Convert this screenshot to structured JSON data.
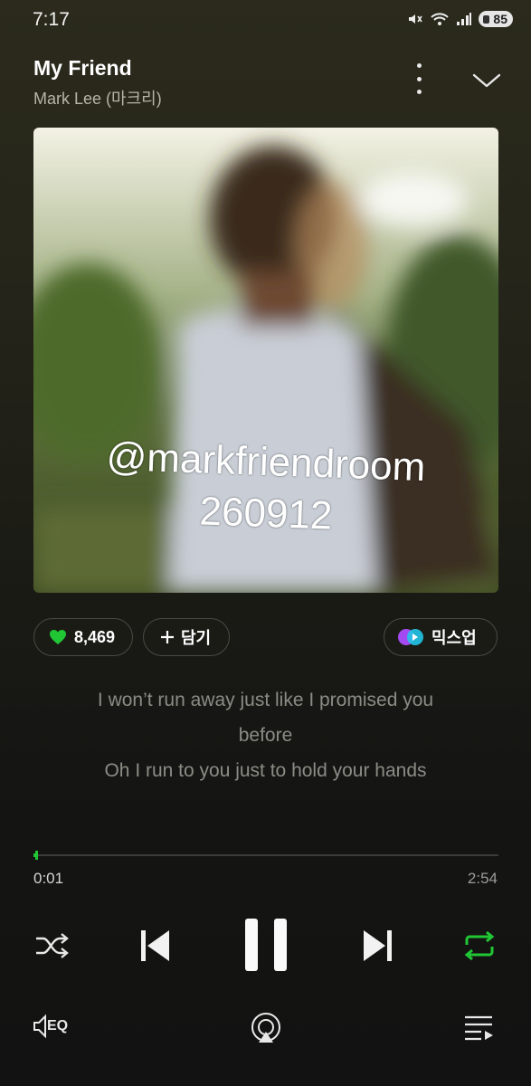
{
  "status_bar": {
    "time": "7:17",
    "battery": "85"
  },
  "song": {
    "title": "My Friend",
    "artist": "Mark Lee (마크리)"
  },
  "artwork": {
    "watermark_line1": "@markfriendroom",
    "watermark_line2": "260912"
  },
  "actions": {
    "like_count": "8,469",
    "add_label": "담기",
    "mixup_label": "믹스업"
  },
  "lyrics": [
    "I won’t run away just like I promised you",
    "before",
    "Oh I run to you just to hold your hands"
  ],
  "progress": {
    "current": "0:01",
    "total": "2:54",
    "fraction": 0.006
  },
  "bottom": {
    "eq_label": "EQ"
  },
  "colors": {
    "accent": "#21c634",
    "background": "#121212"
  },
  "icons": [
    "shuffle-icon",
    "previous-icon",
    "pause-icon",
    "next-icon",
    "repeat-icon",
    "eq-icon",
    "cast-icon",
    "playlist-icon",
    "heart-icon",
    "plus-icon",
    "mixup-icon",
    "more-icon",
    "chevron-down-icon",
    "mute-icon",
    "wifi-icon",
    "signal-icon"
  ]
}
